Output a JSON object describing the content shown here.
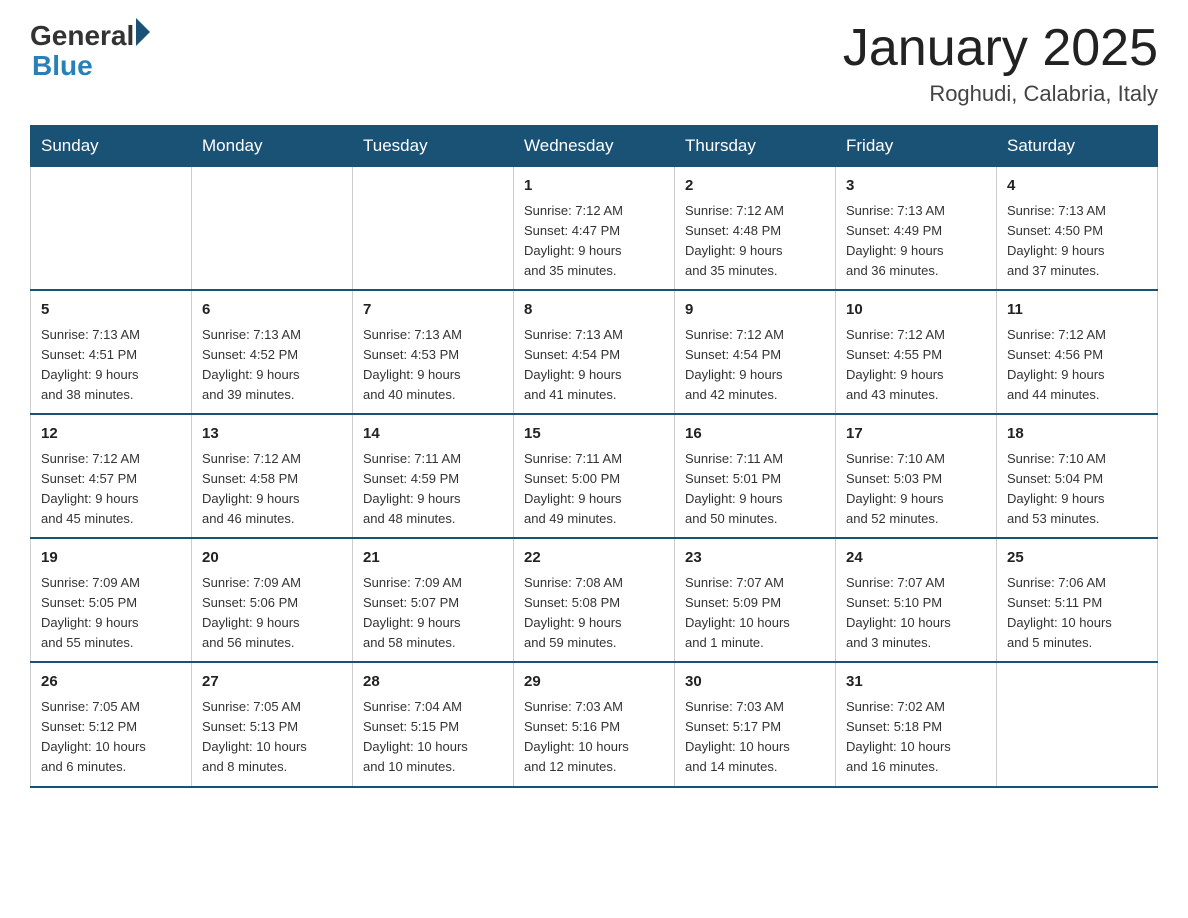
{
  "header": {
    "logo_general": "General",
    "logo_blue": "Blue",
    "title": "January 2025",
    "subtitle": "Roghudi, Calabria, Italy"
  },
  "weekdays": [
    "Sunday",
    "Monday",
    "Tuesday",
    "Wednesday",
    "Thursday",
    "Friday",
    "Saturday"
  ],
  "rows": [
    [
      {
        "day": "",
        "info": ""
      },
      {
        "day": "",
        "info": ""
      },
      {
        "day": "",
        "info": ""
      },
      {
        "day": "1",
        "info": "Sunrise: 7:12 AM\nSunset: 4:47 PM\nDaylight: 9 hours\nand 35 minutes."
      },
      {
        "day": "2",
        "info": "Sunrise: 7:12 AM\nSunset: 4:48 PM\nDaylight: 9 hours\nand 35 minutes."
      },
      {
        "day": "3",
        "info": "Sunrise: 7:13 AM\nSunset: 4:49 PM\nDaylight: 9 hours\nand 36 minutes."
      },
      {
        "day": "4",
        "info": "Sunrise: 7:13 AM\nSunset: 4:50 PM\nDaylight: 9 hours\nand 37 minutes."
      }
    ],
    [
      {
        "day": "5",
        "info": "Sunrise: 7:13 AM\nSunset: 4:51 PM\nDaylight: 9 hours\nand 38 minutes."
      },
      {
        "day": "6",
        "info": "Sunrise: 7:13 AM\nSunset: 4:52 PM\nDaylight: 9 hours\nand 39 minutes."
      },
      {
        "day": "7",
        "info": "Sunrise: 7:13 AM\nSunset: 4:53 PM\nDaylight: 9 hours\nand 40 minutes."
      },
      {
        "day": "8",
        "info": "Sunrise: 7:13 AM\nSunset: 4:54 PM\nDaylight: 9 hours\nand 41 minutes."
      },
      {
        "day": "9",
        "info": "Sunrise: 7:12 AM\nSunset: 4:54 PM\nDaylight: 9 hours\nand 42 minutes."
      },
      {
        "day": "10",
        "info": "Sunrise: 7:12 AM\nSunset: 4:55 PM\nDaylight: 9 hours\nand 43 minutes."
      },
      {
        "day": "11",
        "info": "Sunrise: 7:12 AM\nSunset: 4:56 PM\nDaylight: 9 hours\nand 44 minutes."
      }
    ],
    [
      {
        "day": "12",
        "info": "Sunrise: 7:12 AM\nSunset: 4:57 PM\nDaylight: 9 hours\nand 45 minutes."
      },
      {
        "day": "13",
        "info": "Sunrise: 7:12 AM\nSunset: 4:58 PM\nDaylight: 9 hours\nand 46 minutes."
      },
      {
        "day": "14",
        "info": "Sunrise: 7:11 AM\nSunset: 4:59 PM\nDaylight: 9 hours\nand 48 minutes."
      },
      {
        "day": "15",
        "info": "Sunrise: 7:11 AM\nSunset: 5:00 PM\nDaylight: 9 hours\nand 49 minutes."
      },
      {
        "day": "16",
        "info": "Sunrise: 7:11 AM\nSunset: 5:01 PM\nDaylight: 9 hours\nand 50 minutes."
      },
      {
        "day": "17",
        "info": "Sunrise: 7:10 AM\nSunset: 5:03 PM\nDaylight: 9 hours\nand 52 minutes."
      },
      {
        "day": "18",
        "info": "Sunrise: 7:10 AM\nSunset: 5:04 PM\nDaylight: 9 hours\nand 53 minutes."
      }
    ],
    [
      {
        "day": "19",
        "info": "Sunrise: 7:09 AM\nSunset: 5:05 PM\nDaylight: 9 hours\nand 55 minutes."
      },
      {
        "day": "20",
        "info": "Sunrise: 7:09 AM\nSunset: 5:06 PM\nDaylight: 9 hours\nand 56 minutes."
      },
      {
        "day": "21",
        "info": "Sunrise: 7:09 AM\nSunset: 5:07 PM\nDaylight: 9 hours\nand 58 minutes."
      },
      {
        "day": "22",
        "info": "Sunrise: 7:08 AM\nSunset: 5:08 PM\nDaylight: 9 hours\nand 59 minutes."
      },
      {
        "day": "23",
        "info": "Sunrise: 7:07 AM\nSunset: 5:09 PM\nDaylight: 10 hours\nand 1 minute."
      },
      {
        "day": "24",
        "info": "Sunrise: 7:07 AM\nSunset: 5:10 PM\nDaylight: 10 hours\nand 3 minutes."
      },
      {
        "day": "25",
        "info": "Sunrise: 7:06 AM\nSunset: 5:11 PM\nDaylight: 10 hours\nand 5 minutes."
      }
    ],
    [
      {
        "day": "26",
        "info": "Sunrise: 7:05 AM\nSunset: 5:12 PM\nDaylight: 10 hours\nand 6 minutes."
      },
      {
        "day": "27",
        "info": "Sunrise: 7:05 AM\nSunset: 5:13 PM\nDaylight: 10 hours\nand 8 minutes."
      },
      {
        "day": "28",
        "info": "Sunrise: 7:04 AM\nSunset: 5:15 PM\nDaylight: 10 hours\nand 10 minutes."
      },
      {
        "day": "29",
        "info": "Sunrise: 7:03 AM\nSunset: 5:16 PM\nDaylight: 10 hours\nand 12 minutes."
      },
      {
        "day": "30",
        "info": "Sunrise: 7:03 AM\nSunset: 5:17 PM\nDaylight: 10 hours\nand 14 minutes."
      },
      {
        "day": "31",
        "info": "Sunrise: 7:02 AM\nSunset: 5:18 PM\nDaylight: 10 hours\nand 16 minutes."
      },
      {
        "day": "",
        "info": ""
      }
    ]
  ]
}
